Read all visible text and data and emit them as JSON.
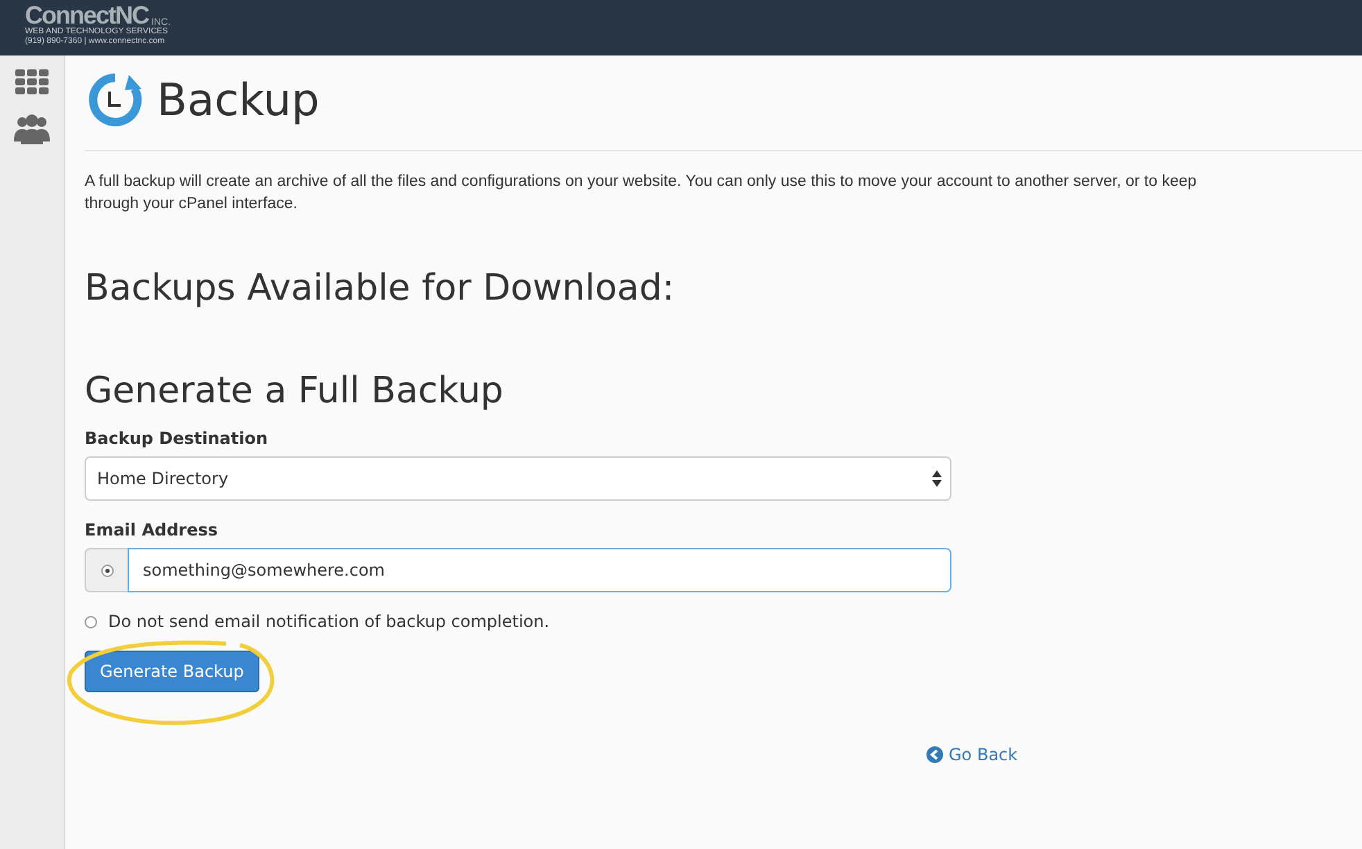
{
  "header": {
    "logo": {
      "name": "ConnectNC",
      "suffix": "INC.",
      "tagline": "WEB AND TECHNOLOGY SERVICES",
      "contact": "(919) 890-7360 | www.connectnc.com"
    }
  },
  "sidebar": {
    "items": [
      {
        "kind": "grid"
      },
      {
        "kind": "users"
      }
    ]
  },
  "page": {
    "title": "Backup",
    "description_lines": [
      "A full backup will create an archive of all the files and configurations on your website. You can only use this to move your account to another server, or to keep",
      "through your cPanel interface."
    ]
  },
  "sections": [
    {
      "heading": "Backups Available for Download:"
    },
    {
      "heading": "Generate a Full Backup"
    }
  ],
  "form": {
    "destination": {
      "label": "Backup Destination",
      "value": "Home Directory"
    },
    "email": {
      "label": "Email Address",
      "value": "something@somewhere.com"
    },
    "notify_options": [
      {
        "kind": "email",
        "selected": true
      },
      {
        "kind": "none",
        "label": "Do not send email notification of backup completion.",
        "selected": false
      }
    ],
    "submit": "Generate Backup"
  },
  "go_back": "Go Back"
}
